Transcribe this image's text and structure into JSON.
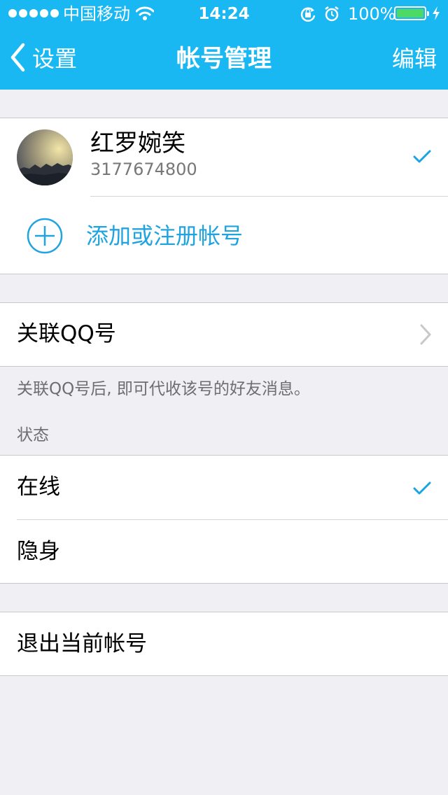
{
  "status_bar": {
    "carrier": "中国移动",
    "time": "14:24",
    "battery_percent": "100%",
    "battery_level": 1.0
  },
  "nav": {
    "back_label": "设置",
    "title": "帐号管理",
    "edit_label": "编辑"
  },
  "accounts": [
    {
      "name": "红罗婉笑",
      "number": "3177674800",
      "selected": true
    }
  ],
  "add_account_label": "添加或注册帐号",
  "link_qq": {
    "label": "关联QQ号",
    "hint": "关联QQ号后, 即可代收该号的好友消息。"
  },
  "status_section": {
    "header": "状态",
    "options": [
      {
        "label": "在线",
        "selected": true
      },
      {
        "label": "隐身",
        "selected": false
      }
    ]
  },
  "logout_label": "退出当前帐号",
  "colors": {
    "nav_background": "#1ab8f2",
    "accent": "#20a4e0",
    "page_background": "#efeff4",
    "battery_fill": "#4cd964"
  },
  "icons": {
    "back": "chevron-left-icon",
    "selected": "checkmark-icon",
    "add": "add-circle-icon",
    "disclosure": "chevron-right-icon"
  }
}
